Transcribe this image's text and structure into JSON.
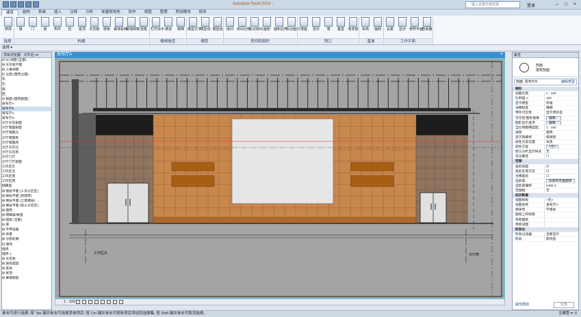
{
  "title_bar": {
    "app_title": "Autodesk Revit 2014 -",
    "search_placeholder": "键入关键字或短语",
    "user_name": "登录",
    "minimize": "–",
    "restore": "□",
    "close": "×"
  },
  "tabs": [
    "建筑",
    "结构",
    "系统",
    "插入",
    "注释",
    "分析",
    "体量和场地",
    "协作",
    "视图",
    "管理",
    "附加模块",
    "修改"
  ],
  "ribbon": {
    "tools": [
      {
        "label": "修改",
        "icon": "select-arrow-icon"
      },
      {
        "label": "墙",
        "icon": "wall-icon"
      },
      {
        "label": "门",
        "icon": "door-icon"
      },
      {
        "label": "窗",
        "icon": "window-icon"
      },
      {
        "label": "构件",
        "icon": "component-icon"
      },
      {
        "label": "柱",
        "icon": "column-icon"
      },
      {
        "label": "屋顶",
        "icon": "roof-icon"
      },
      {
        "label": "天花板",
        "icon": "ceiling-icon"
      },
      {
        "label": "楼板",
        "icon": "floor-icon"
      },
      {
        "label": "幕墙系统",
        "icon": "curtain-system-icon"
      },
      {
        "label": "幕墙网格",
        "icon": "curtain-grid-icon"
      },
      {
        "label": "竖梃",
        "icon": "mullion-icon"
      },
      {
        "label": "栏杆扶手",
        "icon": "railing-icon"
      },
      {
        "label": "坡道",
        "icon": "ramp-icon"
      },
      {
        "label": "楼梯",
        "icon": "stair-icon"
      },
      {
        "label": "模型文字",
        "icon": "model-text-icon"
      },
      {
        "label": "模型线",
        "icon": "model-line-icon"
      },
      {
        "label": "模型组",
        "icon": "model-group-icon"
      },
      {
        "label": "房间",
        "icon": "room-icon"
      },
      {
        "label": "房间分隔",
        "icon": "room-separator-icon"
      },
      {
        "label": "标记房间",
        "icon": "tag-room-icon"
      },
      {
        "label": "面积",
        "icon": "area-icon"
      },
      {
        "label": "面积边界",
        "icon": "area-boundary-icon"
      },
      {
        "label": "标记面积",
        "icon": "tag-area-icon"
      },
      {
        "label": "按面",
        "icon": "by-face-icon"
      },
      {
        "label": "竖井",
        "icon": "shaft-icon"
      },
      {
        "label": "墙",
        "icon": "opening-wall-icon"
      },
      {
        "label": "垂直",
        "icon": "vertical-icon"
      },
      {
        "label": "老虎窗",
        "icon": "dormer-icon"
      },
      {
        "label": "标高",
        "icon": "level-icon"
      },
      {
        "label": "轴网",
        "icon": "grid-icon"
      },
      {
        "label": "设置",
        "icon": "set-icon"
      },
      {
        "label": "显示",
        "icon": "show-icon"
      },
      {
        "label": "参照平面",
        "icon": "ref-plane-icon"
      },
      {
        "label": "查看器",
        "icon": "viewer-icon"
      }
    ],
    "panels": [
      "选择",
      "构建",
      "楼梯坡道",
      "模型",
      "房间和面积",
      "洞口",
      "基准",
      "工作平面"
    ]
  },
  "options_bar": {
    "label": "选择 ▾"
  },
  "project_browser": {
    "header": "项目浏览器 - 文件名.rvt",
    "items": [
      "⊟ [0] 视图 (全部)",
      "  ⊞ 天花板平面",
      "  ⊞ 三维视图",
      "  ⊟ 立面 (建筑立面)",
      "      东",
      "      北",
      "      南",
      "      西",
      "  ⊟ 剖面 (建筑剖面)",
      "      发布厅A",
      "      发布厅B",
      "      发布厅C",
      "      发布厅D",
      "      大厅天花剖面",
      "      大厅墙面剖面",
      "      大厅墙面北",
      "      大厅墙面南",
      "      大厅墙面西",
      "      大厅天花北",
      "      大厅天花南",
      "      大厅门厅",
      "      大厅门厅剖面",
      "      工作区东",
      "      工作区北",
      "      工作区南",
      "      工作区西",
      "      储藏室",
      "  ⊞ 楼层平面 (人员分区区)",
      "  ⊞ 楼层平面 (新建筑)",
      "  ⊞ 楼层平面 (土建楼层)",
      "  ⊞ 楼层平面 (防火分区区)",
      "⊞ 图例",
      "⊞ 明细表/数量",
      "⊞ 图纸 (全部)",
      "⊟ 族",
      "  ⊞ 专用设备",
      "  ⊞ 体量",
      "  ⊞ 分割轮廓",
      "  ⊟ 墙饰",
      "      墙饰",
      "      墙饰 1",
      "  ⊞ 天花板",
      "  ⊞ 填充图案",
      "  ⊞ 家具",
      "  ⊞ 屋顶",
      "  ⊞ 幕墙嵌板"
    ]
  },
  "view": {
    "tab_label": "发布厅A",
    "close": "×",
    "tags": [
      "工作区东",
      "大厅西"
    ]
  },
  "view_control": {
    "scale": "1 : 100"
  },
  "properties": {
    "header": "属性",
    "type_line1": "剖面",
    "type_line2": "建筑剖面",
    "selector": "剖面: 发布厅A",
    "edit_type": "编辑类型",
    "rows": [
      {
        "k": "图形",
        "v": "",
        "grp": true
      },
      {
        "k": "视图比例",
        "v": "1 : 100"
      },
      {
        "k": "比例值 1:",
        "v": "100"
      },
      {
        "k": "显示模型",
        "v": "标准"
      },
      {
        "k": "详细程度",
        "v": "精细"
      },
      {
        "k": "零件可见性",
        "v": "显示原状态"
      },
      {
        "k": "可见性/图形替换",
        "v": "编辑...",
        "btn": true
      },
      {
        "k": "图形显示选项",
        "v": "编辑...",
        "btn": true
      },
      {
        "k": "当比例粗略度超...",
        "v": "1 : 100"
      },
      {
        "k": "规程",
        "v": "建筑"
      },
      {
        "k": "显示隐藏线",
        "v": "按规程"
      },
      {
        "k": "颜色方案位置",
        "v": "背景"
      },
      {
        "k": "颜色方案",
        "v": "<无>",
        "btn": true
      },
      {
        "k": "默认分析显示样式",
        "v": "无"
      },
      {
        "k": "日光路径",
        "v": "☐"
      },
      {
        "k": "范围",
        "v": "",
        "grp": true
      },
      {
        "k": "裁剪视图",
        "v": "☑"
      },
      {
        "k": "裁剪区域可见",
        "v": "☑"
      },
      {
        "k": "注释裁剪",
        "v": "☐"
      },
      {
        "k": "远剪裁",
        "v": "剪裁时无截面线",
        "btn": true
      },
      {
        "k": "远剪裁偏移",
        "v": "5468.3"
      },
      {
        "k": "范围框",
        "v": "无"
      },
      {
        "k": "标识数据",
        "v": "",
        "grp": true
      },
      {
        "k": "视图样板",
        "v": "<无>"
      },
      {
        "k": "视图名称",
        "v": "发布厅A"
      },
      {
        "k": "相关性",
        "v": "不相关"
      },
      {
        "k": "图纸上的标题",
        "v": ""
      },
      {
        "k": "参照图纸",
        "v": ""
      },
      {
        "k": "参照详图",
        "v": ""
      },
      {
        "k": "阶段化",
        "v": "",
        "grp": true
      },
      {
        "k": "阶段过滤器",
        "v": "全部显示"
      },
      {
        "k": "阶段",
        "v": "新构造"
      }
    ],
    "help": "属性帮助",
    "apply": "应用"
  },
  "status_bar": {
    "text": "单击可进行选择; 按 Tab 键并单击可选择其他项目; 按 Ctrl 键并单击可将新项目添加到选择集; 按 Shift 键并单击可取消选择。",
    "right": "主模型 ▾  :0"
  }
}
